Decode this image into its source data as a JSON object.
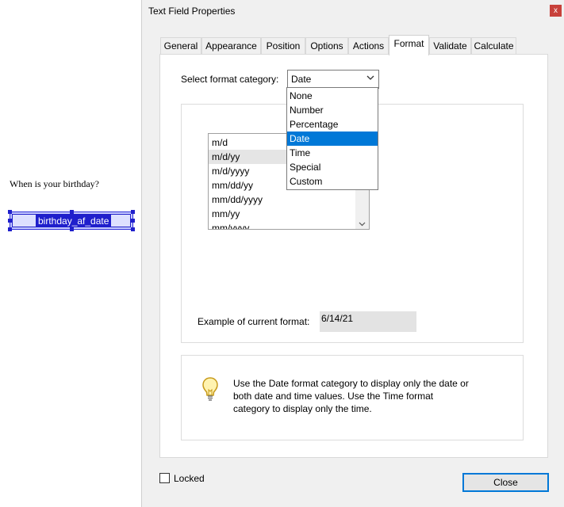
{
  "document": {
    "question": "When is your birthday?",
    "field_name": "birthday_af_date"
  },
  "dialog": {
    "title": "Text Field Properties",
    "close_x": "x",
    "tabs": [
      {
        "label": "General"
      },
      {
        "label": "Appearance"
      },
      {
        "label": "Position"
      },
      {
        "label": "Options"
      },
      {
        "label": "Actions"
      },
      {
        "label": "Format",
        "active": true
      },
      {
        "label": "Validate"
      },
      {
        "label": "Calculate"
      }
    ],
    "format_category_label": "Select format category:",
    "format_category_value": "Date",
    "category_options": [
      "None",
      "Number",
      "Percentage",
      "Date",
      "Time",
      "Special",
      "Custom"
    ],
    "category_selected": "Date",
    "date_formats": [
      "m/d",
      "m/d/yy",
      "m/d/yyyy",
      "mm/dd/yy",
      "mm/dd/yyyy",
      "mm/yy",
      "mm/yyyy"
    ],
    "date_format_selected": "m/d/yy",
    "example_label": "Example of current format:",
    "example_value": "6/14/21",
    "tip_text": "Use the Date format category to display only the date or both date and time values. Use the Time format category to display only the time.",
    "locked_label": "Locked",
    "locked_checked": false,
    "close_button": "Close"
  },
  "icons": {
    "dropdown": "chevron-down-icon",
    "scroll_down": "arrow-down-icon",
    "tip": "lightbulb-icon"
  },
  "colors": {
    "accent": "#0078d7",
    "selection_blue": "#1f1fcc",
    "close_red": "#c8413b"
  }
}
